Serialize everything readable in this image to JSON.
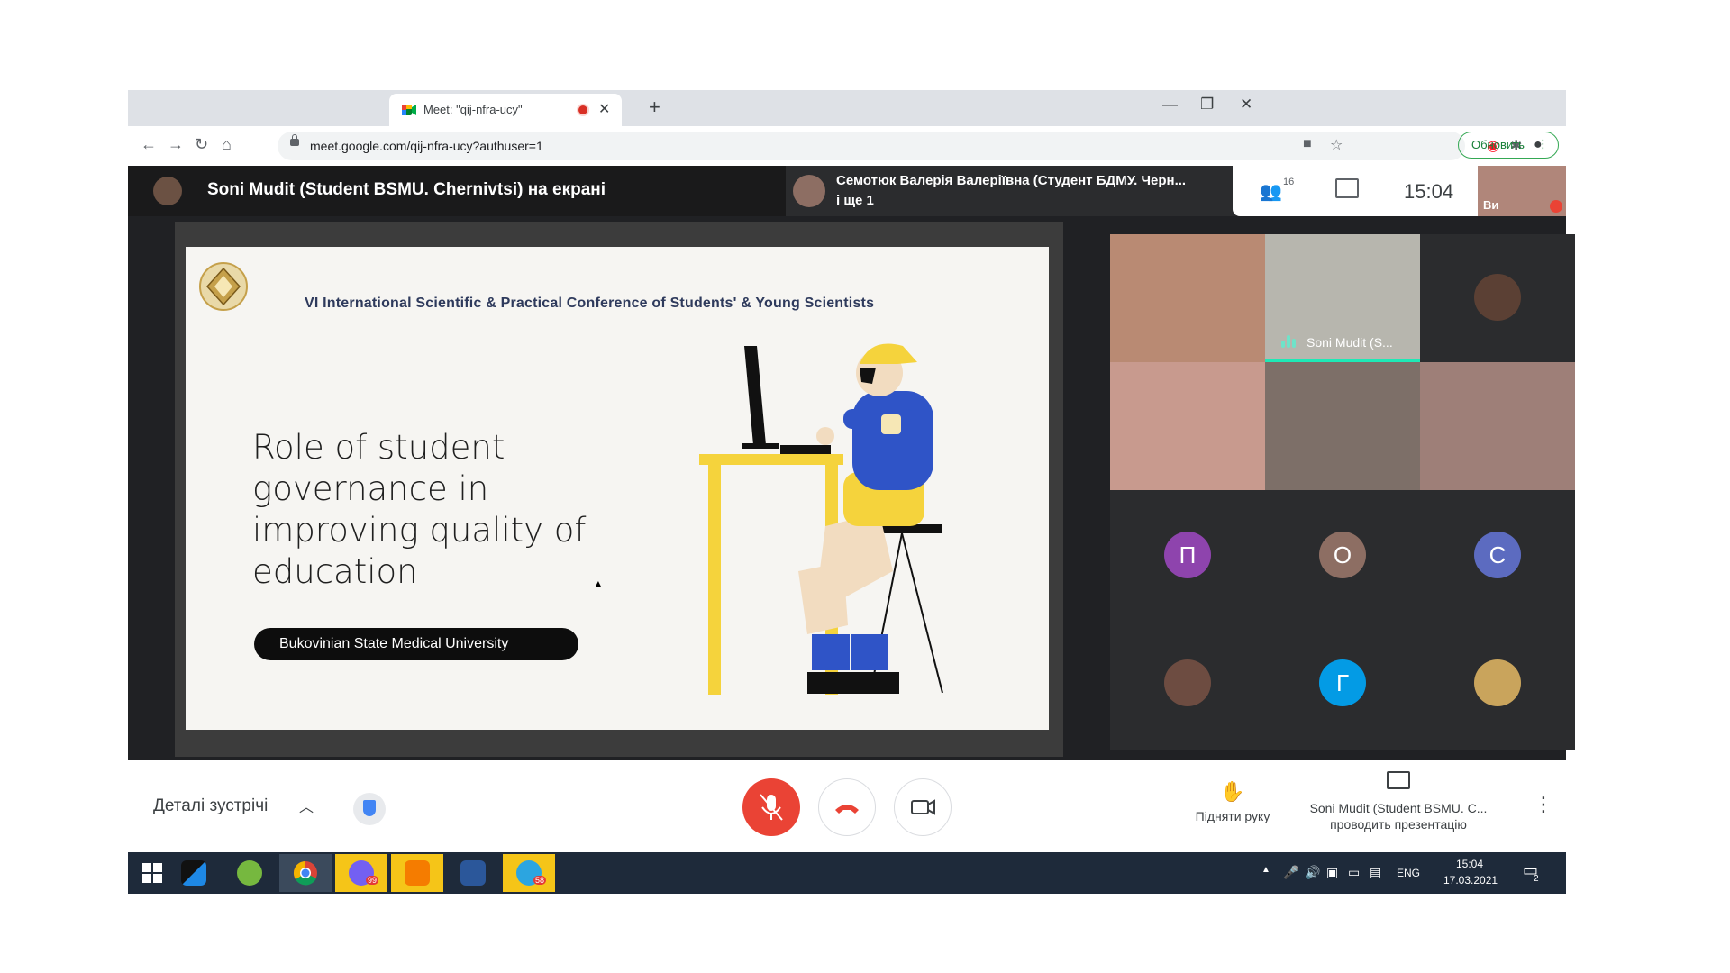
{
  "browser": {
    "tab_title": "Meet: \"qij-nfra-ucy\"",
    "tab_close": "✕",
    "new_tab": "+",
    "minimize": "—",
    "restore": "❐",
    "close": "✕",
    "url": "meet.google.com/qij-nfra-ucy?authuser=1",
    "update_button": "Обновить",
    "update_menu": "⋮"
  },
  "meet": {
    "presenter_title": "Soni Mudit (Student BSMU. Chernivtsi) на екрані",
    "speaker_name": "Семотюк Валерія Валеріївна (Студент БДМУ. Черн...",
    "speaker_more": "і ще 1",
    "people_count": "16",
    "clock": "15:04",
    "self_label": "Ви"
  },
  "slide": {
    "conference_title": "VI International Scientific & Practical Conference of Students' & Young Scientists",
    "heading": "Role of student governance in improving quality of education",
    "university": "Bukovinian State Medical University"
  },
  "participants": [
    {
      "type": "video",
      "color": "#b98a73"
    },
    {
      "type": "video",
      "color": "#b7b6ae",
      "name": "Soni Mudit (S...",
      "speaking": true
    },
    {
      "type": "photo",
      "color": "#5b4034"
    },
    {
      "type": "video",
      "color": "#c89a8e"
    },
    {
      "type": "video",
      "color": "#7d6f68"
    },
    {
      "type": "video",
      "color": "#9e7f78"
    },
    {
      "type": "letter",
      "letter": "П",
      "color": "#8e44ad"
    },
    {
      "type": "letter",
      "letter": "О",
      "color": "#8d6e63"
    },
    {
      "type": "letter",
      "letter": "С",
      "color": "#5c6bc0"
    },
    {
      "type": "photo",
      "color": "#6d4c41"
    },
    {
      "type": "letter",
      "letter": "Г",
      "color": "#039be5"
    },
    {
      "type": "photo",
      "color": "#c9a45c"
    }
  ],
  "controls": {
    "details": "Деталі зустрічі",
    "raise_hand": "Підняти руку",
    "presenter_name": "Soni Mudit (Student BSMU. C...",
    "presenting": "проводить презентацію",
    "more": "⋮"
  },
  "taskbar": {
    "lang": "ENG",
    "time": "15:04",
    "date": "17.03.2021",
    "notif_count": "2",
    "viber_badge": "99",
    "telegram_badge": "58"
  },
  "colors": {
    "meet_bg": "#202124",
    "mic_red": "#ea4335",
    "speaking": "#1de9b6",
    "slide_yellow": "#f5d33c",
    "slide_blue": "#2f54c7"
  }
}
